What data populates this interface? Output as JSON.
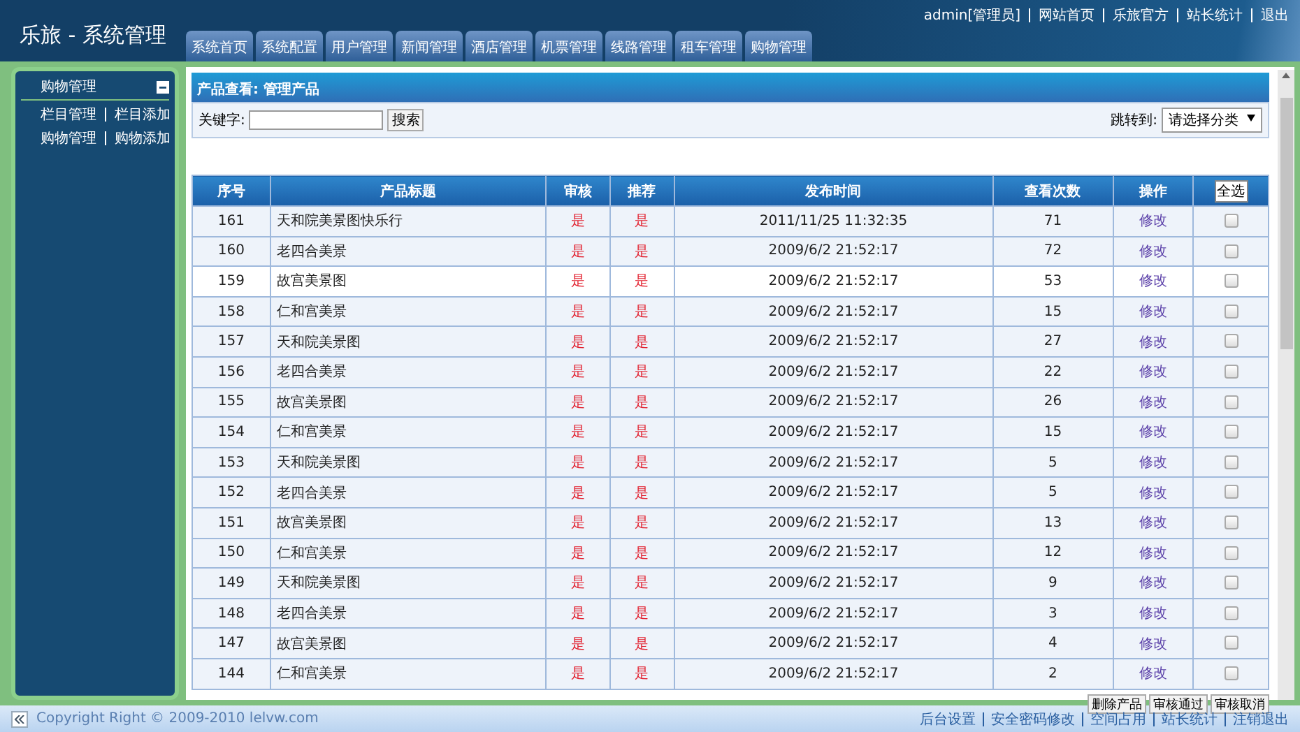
{
  "header": {
    "title": "乐旅 - 系统管理",
    "user": "admin[管理员]",
    "links": [
      "网站首页",
      "乐旅官方",
      "站长统计",
      "退出"
    ]
  },
  "tabs": [
    "系统首页",
    "系统配置",
    "用户管理",
    "新闻管理",
    "酒店管理",
    "机票管理",
    "线路管理",
    "租车管理",
    "购物管理"
  ],
  "sidebar": {
    "title": "购物管理",
    "expanded": true,
    "links": [
      [
        "栏目管理",
        "栏目添加"
      ],
      [
        "购物管理",
        "购物添加"
      ]
    ]
  },
  "panel": {
    "title": "产品查看: 管理产品",
    "search_label": "关键字:",
    "search_button": "搜索",
    "jump_label": "跳转到:",
    "jump_select": "请选择分类"
  },
  "table": {
    "columns": [
      "序号",
      "产品标题",
      "审核",
      "推荐",
      "发布时间",
      "查看次数",
      "操作",
      "全选"
    ],
    "rows": [
      {
        "id": "161",
        "title": "天和院美景图快乐行",
        "audit": "是",
        "recommend": "是",
        "time": "2011/11/25 11:32:35",
        "views": "71",
        "action": "修改",
        "checked": false,
        "highlighted": false
      },
      {
        "id": "160",
        "title": "老四合美景",
        "audit": "是",
        "recommend": "是",
        "time": "2009/6/2 21:52:17",
        "views": "72",
        "action": "修改",
        "checked": false,
        "highlighted": false
      },
      {
        "id": "159",
        "title": "故宫美景图",
        "audit": "是",
        "recommend": "是",
        "time": "2009/6/2 21:52:17",
        "views": "53",
        "action": "修改",
        "checked": false,
        "highlighted": true
      },
      {
        "id": "158",
        "title": "仁和宫美景",
        "audit": "是",
        "recommend": "是",
        "time": "2009/6/2 21:52:17",
        "views": "15",
        "action": "修改",
        "checked": false,
        "highlighted": false
      },
      {
        "id": "157",
        "title": "天和院美景图",
        "audit": "是",
        "recommend": "是",
        "time": "2009/6/2 21:52:17",
        "views": "27",
        "action": "修改",
        "checked": false,
        "highlighted": false
      },
      {
        "id": "156",
        "title": "老四合美景",
        "audit": "是",
        "recommend": "是",
        "time": "2009/6/2 21:52:17",
        "views": "22",
        "action": "修改",
        "checked": false,
        "highlighted": false
      },
      {
        "id": "155",
        "title": "故宫美景图",
        "audit": "是",
        "recommend": "是",
        "time": "2009/6/2 21:52:17",
        "views": "26",
        "action": "修改",
        "checked": false,
        "highlighted": false
      },
      {
        "id": "154",
        "title": "仁和宫美景",
        "audit": "是",
        "recommend": "是",
        "time": "2009/6/2 21:52:17",
        "views": "15",
        "action": "修改",
        "checked": false,
        "highlighted": false
      },
      {
        "id": "153",
        "title": "天和院美景图",
        "audit": "是",
        "recommend": "是",
        "time": "2009/6/2 21:52:17",
        "views": "5",
        "action": "修改",
        "checked": false,
        "highlighted": false
      },
      {
        "id": "152",
        "title": "老四合美景",
        "audit": "是",
        "recommend": "是",
        "time": "2009/6/2 21:52:17",
        "views": "5",
        "action": "修改",
        "checked": false,
        "highlighted": false
      },
      {
        "id": "151",
        "title": "故宫美景图",
        "audit": "是",
        "recommend": "是",
        "time": "2009/6/2 21:52:17",
        "views": "13",
        "action": "修改",
        "checked": false,
        "highlighted": false
      },
      {
        "id": "150",
        "title": "仁和宫美景",
        "audit": "是",
        "recommend": "是",
        "time": "2009/6/2 21:52:17",
        "views": "12",
        "action": "修改",
        "checked": false,
        "highlighted": false
      },
      {
        "id": "149",
        "title": "天和院美景图",
        "audit": "是",
        "recommend": "是",
        "time": "2009/6/2 21:52:17",
        "views": "9",
        "action": "修改",
        "checked": false,
        "highlighted": false
      },
      {
        "id": "148",
        "title": "老四合美景",
        "audit": "是",
        "recommend": "是",
        "time": "2009/6/2 21:52:17",
        "views": "3",
        "action": "修改",
        "checked": false,
        "highlighted": false
      },
      {
        "id": "147",
        "title": "故宫美景图",
        "audit": "是",
        "recommend": "是",
        "time": "2009/6/2 21:52:17",
        "views": "4",
        "action": "修改",
        "checked": false,
        "highlighted": false
      },
      {
        "id": "144",
        "title": "仁和宫美景",
        "audit": "是",
        "recommend": "是",
        "time": "2009/6/2 21:52:17",
        "views": "2",
        "action": "修改",
        "checked": false,
        "highlighted": false
      }
    ]
  },
  "table_buttons": [
    "删除产品",
    "审核通过",
    "审核取消"
  ],
  "footer": {
    "copyright": "Copyright Right © 2009-2010 lelvw.com",
    "links": [
      "后台设置",
      "安全密码修改",
      "空间占用",
      "站长统计",
      "注销退出"
    ]
  }
}
